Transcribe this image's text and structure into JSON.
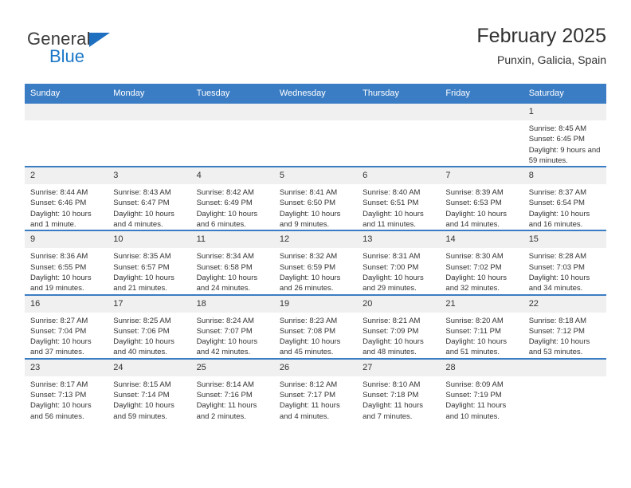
{
  "brand": {
    "name_top": "General",
    "name_bottom": "Blue",
    "triangle_color": "#1f6fc0",
    "blue_color": "#1a77c8"
  },
  "header": {
    "title": "February 2025",
    "subtitle": "Punxin, Galicia, Spain"
  },
  "colors": {
    "header_blue": "#3b7dc4",
    "daynum_gray": "#f0f0f0",
    "text": "#333333"
  },
  "weekdays": [
    "Sunday",
    "Monday",
    "Tuesday",
    "Wednesday",
    "Thursday",
    "Friday",
    "Saturday"
  ],
  "labels": {
    "sunrise": "Sunrise:",
    "sunset": "Sunset:",
    "daylight": "Daylight:"
  },
  "weeks": [
    [
      {
        "day": "",
        "blank": true
      },
      {
        "day": "",
        "blank": true
      },
      {
        "day": "",
        "blank": true
      },
      {
        "day": "",
        "blank": true
      },
      {
        "day": "",
        "blank": true
      },
      {
        "day": "",
        "blank": true
      },
      {
        "day": "1",
        "sunrise": "Sunrise: 8:45 AM",
        "sunset": "Sunset: 6:45 PM",
        "daylight": "Daylight: 9 hours and 59 minutes."
      }
    ],
    [
      {
        "day": "2",
        "sunrise": "Sunrise: 8:44 AM",
        "sunset": "Sunset: 6:46 PM",
        "daylight": "Daylight: 10 hours and 1 minute."
      },
      {
        "day": "3",
        "sunrise": "Sunrise: 8:43 AM",
        "sunset": "Sunset: 6:47 PM",
        "daylight": "Daylight: 10 hours and 4 minutes."
      },
      {
        "day": "4",
        "sunrise": "Sunrise: 8:42 AM",
        "sunset": "Sunset: 6:49 PM",
        "daylight": "Daylight: 10 hours and 6 minutes."
      },
      {
        "day": "5",
        "sunrise": "Sunrise: 8:41 AM",
        "sunset": "Sunset: 6:50 PM",
        "daylight": "Daylight: 10 hours and 9 minutes."
      },
      {
        "day": "6",
        "sunrise": "Sunrise: 8:40 AM",
        "sunset": "Sunset: 6:51 PM",
        "daylight": "Daylight: 10 hours and 11 minutes."
      },
      {
        "day": "7",
        "sunrise": "Sunrise: 8:39 AM",
        "sunset": "Sunset: 6:53 PM",
        "daylight": "Daylight: 10 hours and 14 minutes."
      },
      {
        "day": "8",
        "sunrise": "Sunrise: 8:37 AM",
        "sunset": "Sunset: 6:54 PM",
        "daylight": "Daylight: 10 hours and 16 minutes."
      }
    ],
    [
      {
        "day": "9",
        "sunrise": "Sunrise: 8:36 AM",
        "sunset": "Sunset: 6:55 PM",
        "daylight": "Daylight: 10 hours and 19 minutes."
      },
      {
        "day": "10",
        "sunrise": "Sunrise: 8:35 AM",
        "sunset": "Sunset: 6:57 PM",
        "daylight": "Daylight: 10 hours and 21 minutes."
      },
      {
        "day": "11",
        "sunrise": "Sunrise: 8:34 AM",
        "sunset": "Sunset: 6:58 PM",
        "daylight": "Daylight: 10 hours and 24 minutes."
      },
      {
        "day": "12",
        "sunrise": "Sunrise: 8:32 AM",
        "sunset": "Sunset: 6:59 PM",
        "daylight": "Daylight: 10 hours and 26 minutes."
      },
      {
        "day": "13",
        "sunrise": "Sunrise: 8:31 AM",
        "sunset": "Sunset: 7:00 PM",
        "daylight": "Daylight: 10 hours and 29 minutes."
      },
      {
        "day": "14",
        "sunrise": "Sunrise: 8:30 AM",
        "sunset": "Sunset: 7:02 PM",
        "daylight": "Daylight: 10 hours and 32 minutes."
      },
      {
        "day": "15",
        "sunrise": "Sunrise: 8:28 AM",
        "sunset": "Sunset: 7:03 PM",
        "daylight": "Daylight: 10 hours and 34 minutes."
      }
    ],
    [
      {
        "day": "16",
        "sunrise": "Sunrise: 8:27 AM",
        "sunset": "Sunset: 7:04 PM",
        "daylight": "Daylight: 10 hours and 37 minutes."
      },
      {
        "day": "17",
        "sunrise": "Sunrise: 8:25 AM",
        "sunset": "Sunset: 7:06 PM",
        "daylight": "Daylight: 10 hours and 40 minutes."
      },
      {
        "day": "18",
        "sunrise": "Sunrise: 8:24 AM",
        "sunset": "Sunset: 7:07 PM",
        "daylight": "Daylight: 10 hours and 42 minutes."
      },
      {
        "day": "19",
        "sunrise": "Sunrise: 8:23 AM",
        "sunset": "Sunset: 7:08 PM",
        "daylight": "Daylight: 10 hours and 45 minutes."
      },
      {
        "day": "20",
        "sunrise": "Sunrise: 8:21 AM",
        "sunset": "Sunset: 7:09 PM",
        "daylight": "Daylight: 10 hours and 48 minutes."
      },
      {
        "day": "21",
        "sunrise": "Sunrise: 8:20 AM",
        "sunset": "Sunset: 7:11 PM",
        "daylight": "Daylight: 10 hours and 51 minutes."
      },
      {
        "day": "22",
        "sunrise": "Sunrise: 8:18 AM",
        "sunset": "Sunset: 7:12 PM",
        "daylight": "Daylight: 10 hours and 53 minutes."
      }
    ],
    [
      {
        "day": "23",
        "sunrise": "Sunrise: 8:17 AM",
        "sunset": "Sunset: 7:13 PM",
        "daylight": "Daylight: 10 hours and 56 minutes."
      },
      {
        "day": "24",
        "sunrise": "Sunrise: 8:15 AM",
        "sunset": "Sunset: 7:14 PM",
        "daylight": "Daylight: 10 hours and 59 minutes."
      },
      {
        "day": "25",
        "sunrise": "Sunrise: 8:14 AM",
        "sunset": "Sunset: 7:16 PM",
        "daylight": "Daylight: 11 hours and 2 minutes."
      },
      {
        "day": "26",
        "sunrise": "Sunrise: 8:12 AM",
        "sunset": "Sunset: 7:17 PM",
        "daylight": "Daylight: 11 hours and 4 minutes."
      },
      {
        "day": "27",
        "sunrise": "Sunrise: 8:10 AM",
        "sunset": "Sunset: 7:18 PM",
        "daylight": "Daylight: 11 hours and 7 minutes."
      },
      {
        "day": "28",
        "sunrise": "Sunrise: 8:09 AM",
        "sunset": "Sunset: 7:19 PM",
        "daylight": "Daylight: 11 hours and 10 minutes."
      },
      {
        "day": "",
        "blank": true
      }
    ]
  ]
}
